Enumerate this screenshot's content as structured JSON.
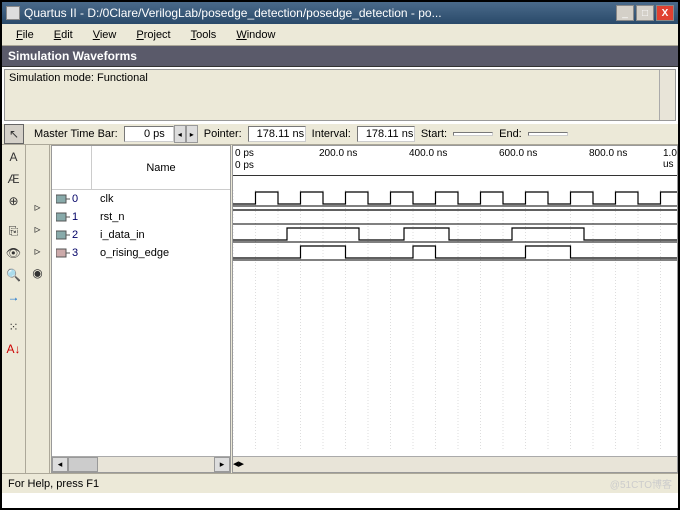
{
  "window": {
    "title": "Quartus II - D:/0Clare/VerilogLab/posedge_detection/posedge_detection - po..."
  },
  "menu": {
    "file": "File",
    "edit": "Edit",
    "view": "View",
    "project": "Project",
    "tools": "Tools",
    "window": "Window"
  },
  "panel": {
    "title": "Simulation Waveforms",
    "mode": "Simulation mode: Functional"
  },
  "timebar": {
    "master_label": "Master Time Bar:",
    "master_val": "0 ps",
    "pointer_label": "Pointer:",
    "pointer_val": "178.11 ns",
    "interval_label": "Interval:",
    "interval_val": "178.11 ns",
    "start_label": "Start:",
    "start_val": "",
    "end_label": "End:",
    "end_val": ""
  },
  "columns": {
    "name": "Name"
  },
  "ruler": {
    "top_origin": "0 ps",
    "origin": "0 ps",
    "ticks": [
      "200.0 ns",
      "400.0 ns",
      "600.0 ns",
      "800.0 ns",
      "1.0 us"
    ]
  },
  "signals": [
    {
      "idx": "0",
      "name": "clk",
      "dir": "in"
    },
    {
      "idx": "1",
      "name": "rst_n",
      "dir": "in"
    },
    {
      "idx": "2",
      "name": "i_data_in",
      "dir": "in"
    },
    {
      "idx": "3",
      "name": "o_rising_edge",
      "dir": "out"
    }
  ],
  "chart_data": {
    "type": "digital-waveform",
    "time_unit": "ns",
    "time_range": [
      0,
      1000
    ],
    "signals": [
      {
        "name": "clk",
        "period_ns": 100,
        "duty": 0.5,
        "initial": 0
      },
      {
        "name": "rst_n",
        "edges_ns": [],
        "initial": 1
      },
      {
        "name": "i_data_in",
        "edges_ns": [
          120,
          280,
          380,
          480,
          620,
          780
        ],
        "initial": 0
      },
      {
        "name": "o_rising_edge",
        "edges_ns": [
          150,
          250,
          400,
          450,
          650,
          750
        ],
        "initial": 0
      }
    ]
  },
  "status": {
    "help": "For Help, press F1",
    "credit": "@51CTO博客"
  }
}
